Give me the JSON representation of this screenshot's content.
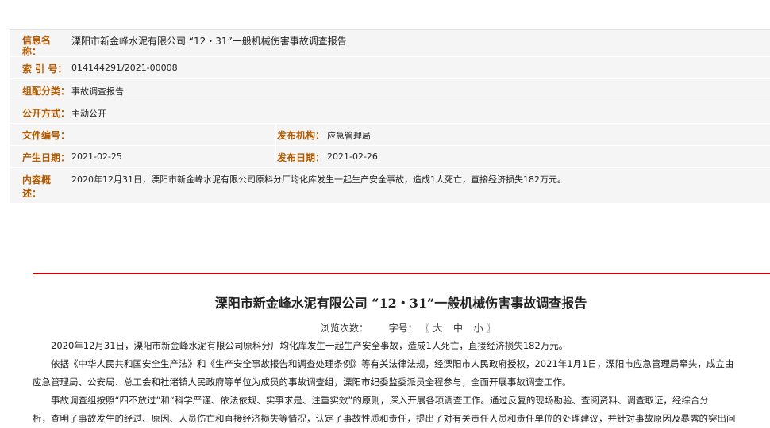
{
  "meta": {
    "name_label_1": "信息名",
    "name_label_2": "称：",
    "name_value": "溧阳市新金峰水泥有限公司 “12・31”一般机械伤害事故调查报告",
    "index_label": "索 引 号：",
    "index_value": "014144291/2021-00008",
    "category_label": "组配分类：",
    "category_value": "事故调查报告",
    "disclosure_label": "公开方式：",
    "disclosure_value": "主动公开",
    "docno_label": "文件编号：",
    "docno_value": "",
    "issuer_label": "发布机构：",
    "issuer_value": "应急管理局",
    "created_label": "产生日期：",
    "created_value": "2021-02-25",
    "published_label": "发布日期：",
    "published_value": "2021-02-26",
    "summary_label_1": "内容概",
    "summary_label_2": "述：",
    "summary_value": "2020年12月31日，溧阳市新金峰水泥有限公司原料分厂均化库发生一起生产安全事故，造成1人死亡，直接经济损失182万元。"
  },
  "article": {
    "title": "溧阳市新金峰水泥有限公司 “12・31”一般机械伤害事故调查报告",
    "views_label": "浏览次数：",
    "fontsize_label": "字号：",
    "bracket_open": "〖",
    "size_large": "大",
    "size_medium": "中",
    "size_small": "小",
    "bracket_close": "〗",
    "para1": "　　2020年12月31日，溧阳市新金峰水泥有限公司原料分厂均化库发生一起生产安全事故，造成1人死亡，直接经济损失182万元。",
    "para2_line1": "　　依据《中华人民共和国安全生产法》和《生产安全事故报告和调查处理条例》等有关法律法规，经溧阳市人民政府授权，2021年1月1日，溧阳市应急管理局牵头，成立由",
    "para2_line2": "应急管理局、公安局、总工会和社渚镇人民政府等单位为成员的事故调查组，溧阳市纪委监委派员全程参与，全面开展事故调查工作。",
    "para3_line1": "　　事故调查组按照“四不放过”和“科学严谨、依法依规、实事求是、注重实效”的原则，深入开展各项调查工作。通过反复的现场勘验、查阅资料、调查取证，经综合分",
    "para3_line2": "析，查明了事故发生的经过、原因、人员伤亡和直接经济损失等情况，认定了事故性质和责任，提出了对有关责任人员和责任单位的处理建议，并针对事故原因及暴露的突出问"
  }
}
